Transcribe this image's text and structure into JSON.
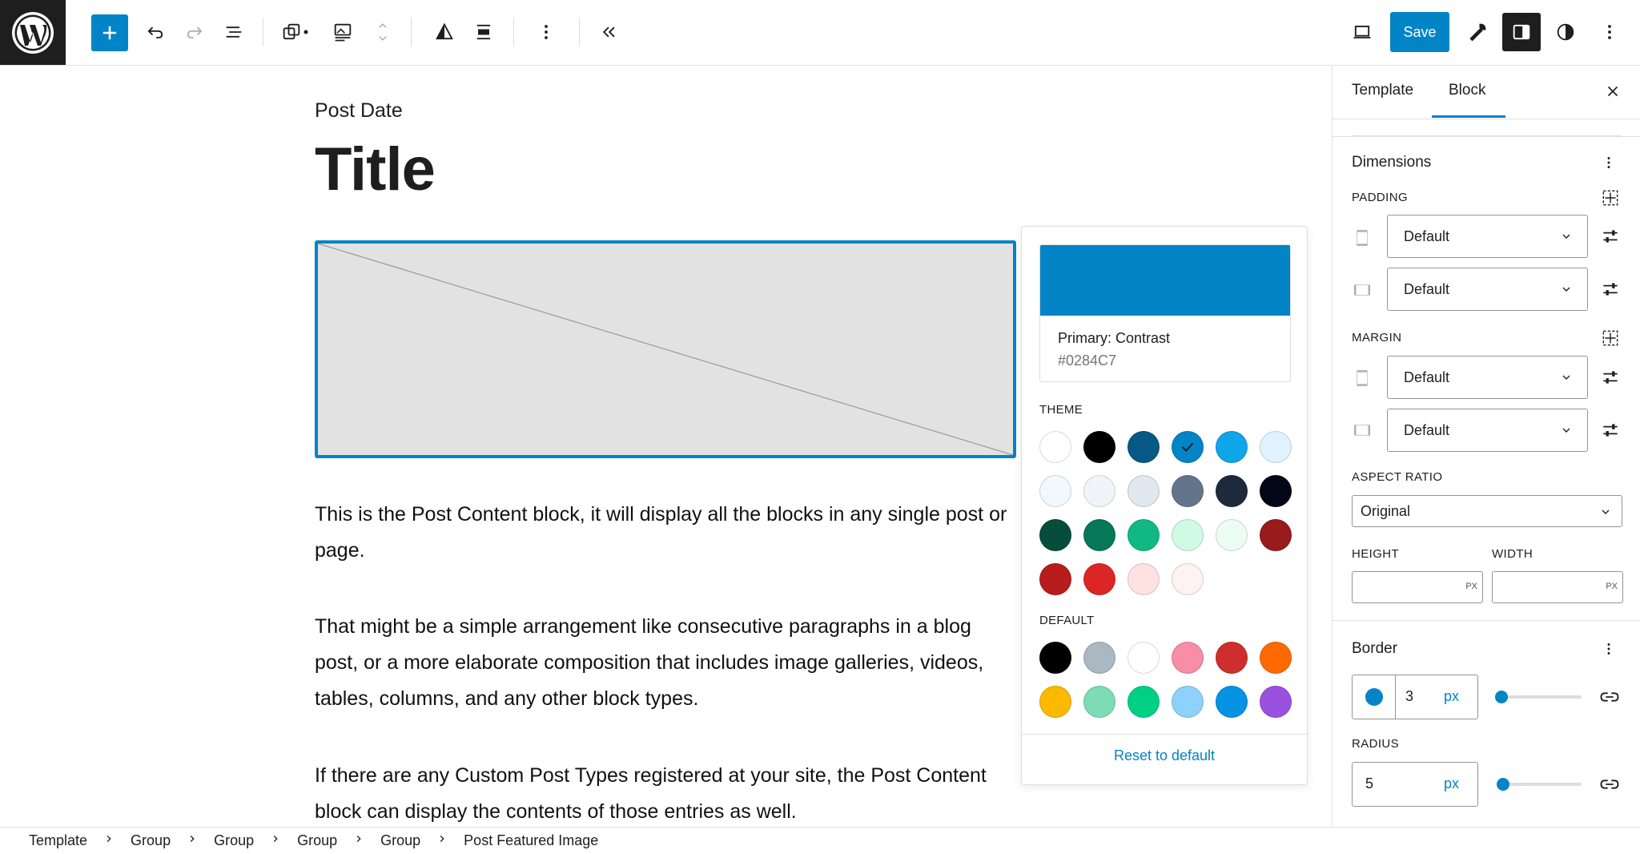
{
  "toolbar": {
    "save_label": "Save"
  },
  "canvas": {
    "post_date": "Post Date",
    "title": "Title",
    "paragraphs": [
      "This is the Post Content block, it will display all the blocks in any single post or page.",
      "That might be a simple arrangement like consecutive paragraphs in a blog post, or a more elaborate composition that includes image galleries, videos, tables, columns, and any other block types.",
      "If there are any Custom Post Types registered at your site, the Post Content block can display the contents of those entries as well."
    ]
  },
  "color_popover": {
    "selected_name": "Primary: Contrast",
    "selected_hex": "#0284C7",
    "theme_label": "THEME",
    "default_label": "DEFAULT",
    "reset_label": "Reset to default",
    "theme_colors": [
      "#ffffff",
      "#000000",
      "#075985",
      "#0284c7",
      "#0ea5e9",
      "#e0f2fe",
      "#f0f9ff",
      "#f1f5f9",
      "#e2e8f0",
      "#64748b",
      "#1e293b",
      "#020617",
      "#064e3b",
      "#047857",
      "#10b981",
      "#d1fae5",
      "#ecfdf5",
      "#991b1b",
      "#b91c1c",
      "#dc2626",
      "#fee2e2",
      "#fef2f2"
    ],
    "default_colors": [
      "#000000",
      "#abb8c3",
      "#ffffff",
      "#f78da7",
      "#cf2e2e",
      "#ff6900",
      "#fcb900",
      "#7bdcb5",
      "#00d084",
      "#8ed1fc",
      "#0693e3",
      "#9b51e0"
    ],
    "selected_index": 3
  },
  "sidebar": {
    "tabs": [
      "Template",
      "Block"
    ],
    "active_tab": "Block",
    "dimensions": {
      "heading": "Dimensions",
      "padding_label": "PADDING",
      "margin_label": "MARGIN",
      "padding_vertical": "Default",
      "padding_horizontal": "Default",
      "margin_vertical": "Default",
      "margin_horizontal": "Default",
      "aspect_ratio_label": "ASPECT RATIO",
      "aspect_ratio_value": "Original",
      "height_label": "HEIGHT",
      "width_label": "WIDTH",
      "unit": "PX"
    },
    "border": {
      "heading": "Border",
      "width_value": "3",
      "width_unit": "px",
      "radius_label": "RADIUS",
      "radius_value": "5",
      "radius_unit": "px",
      "color": "#0284c7"
    }
  },
  "breadcrumb": [
    "Template",
    "Group",
    "Group",
    "Group",
    "Group",
    "Post Featured Image"
  ]
}
